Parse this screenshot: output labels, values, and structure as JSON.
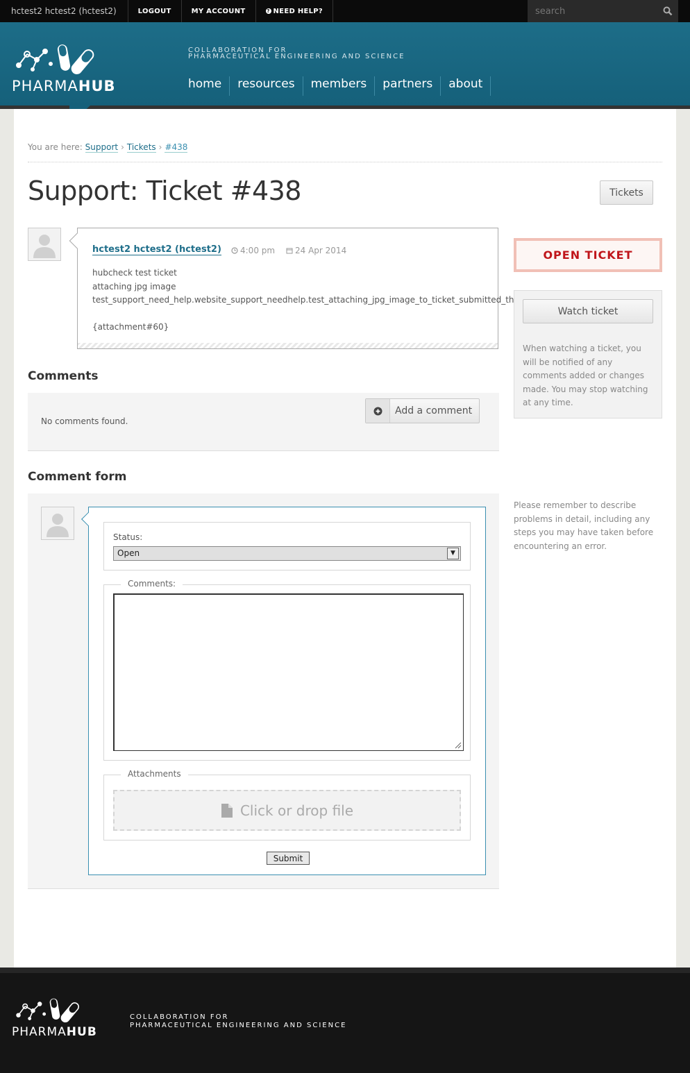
{
  "topbar": {
    "user": "hctest2 hctest2 (hctest2)",
    "logout": "LOGOUT",
    "my_account": "MY ACCOUNT",
    "need_help": "NEED HELP?",
    "search_placeholder": "search"
  },
  "header": {
    "logo_light": "PHARMA",
    "logo_bold": "HUB",
    "tagline_1": "COLLABORATION FOR",
    "tagline_2": "PHARMACEUTICAL ENGINEERING AND SCIENCE",
    "nav": [
      "home",
      "resources",
      "members",
      "partners",
      "about"
    ]
  },
  "breadcrumb": {
    "prefix": "You are here:",
    "items": [
      "Support",
      "Tickets",
      "#438"
    ]
  },
  "page": {
    "title": "Support: Ticket #438",
    "tickets_button": "Tickets"
  },
  "ticket": {
    "author": "hctest2 hctest2 (hctest2)",
    "time": "4:00 pm",
    "date": "24 Apr 2014",
    "lines": [
      "hubcheck test ticket",
      "attaching jpg image",
      "test_support_need_help.website_support_needhelp.test_attaching_jpg_image_to_ticket_submitted_through_need_help",
      "{attachment#60}"
    ]
  },
  "sidebar": {
    "open_ticket": "OPEN TICKET",
    "watch_button": "Watch ticket",
    "watch_text": "When watching a ticket, you will be notified of any comments added or changes made. You may stop watching at any time.",
    "reminder": "Please remember to describe problems in detail, including any steps you may have taken before encountering an error."
  },
  "comments": {
    "title": "Comments",
    "empty": "No comments found.",
    "add_button": "Add a comment"
  },
  "form": {
    "title": "Comment form",
    "status_label": "Status:",
    "status_value": "Open",
    "comments_legend": "Comments:",
    "comments_value": "",
    "attachments_legend": "Attachments",
    "dropzone": "Click or drop file",
    "submit": "Submit"
  },
  "footer": {
    "logo_light": "PHARMA",
    "logo_bold": "HUB",
    "tagline_1": "COLLABORATION FOR",
    "tagline_2": "PHARMACEUTICAL ENGINEERING AND SCIENCE"
  },
  "colors": {
    "header_blue": "#1d6d88",
    "link": "#1e6e8a",
    "open_ticket_red": "#c0161b",
    "form_border": "#3a8fb0"
  }
}
